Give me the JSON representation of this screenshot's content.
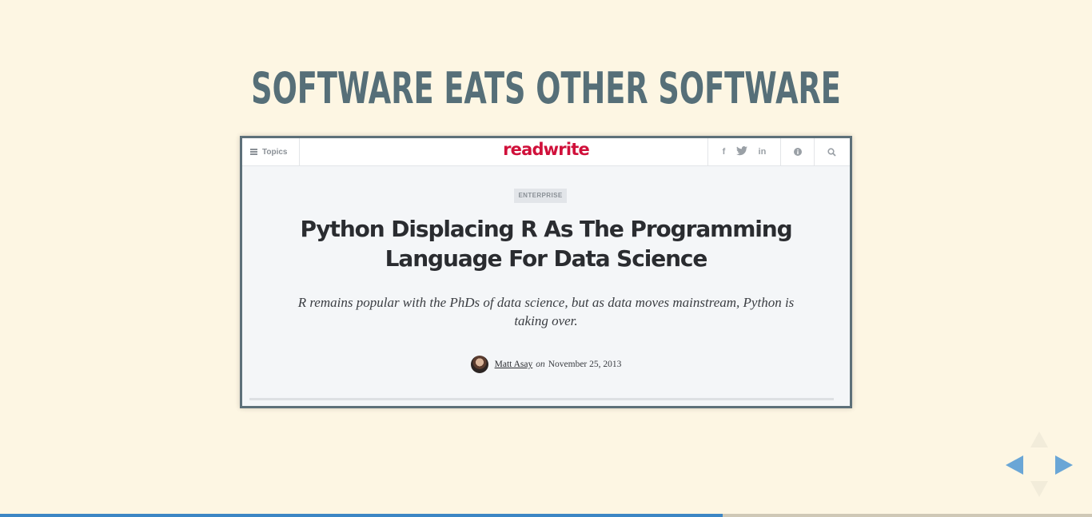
{
  "slide": {
    "title": "SOFTWARE EATS OTHER SOFTWARE"
  },
  "article": {
    "header": {
      "topics_label": "Topics",
      "logo_text": "readwrite",
      "social": [
        "f",
        "🐦",
        "in"
      ],
      "icons": [
        "hamburger-icon",
        "facebook-icon",
        "twitter-icon",
        "linkedin-icon",
        "info-icon",
        "search-icon"
      ]
    },
    "category": "ENTERPRISE",
    "headline": "Python Displacing R As The Programming Language For Data Science",
    "dek": "R remains popular with the PhDs of data science, but as data moves mainstream, Python is taking over.",
    "byline": {
      "author": "Matt Asay",
      "on": "on",
      "date": "November 25, 2013"
    }
  },
  "colors": {
    "background": "#fdf6e3",
    "title": "#566f78",
    "logo": "#d0103a",
    "progress": "#3d86c4",
    "nav_arrow": "#6aa6d6"
  },
  "progress": {
    "fraction": 0.662
  }
}
